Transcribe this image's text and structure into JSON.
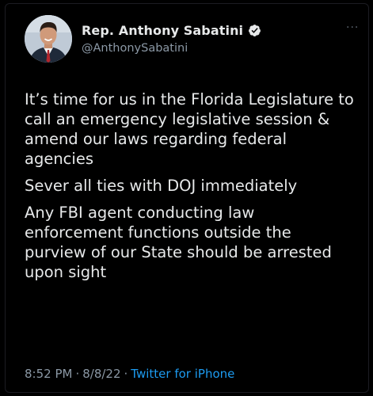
{
  "colors": {
    "background": "#000000",
    "text_primary": "#e7e9ea",
    "text_secondary": "#8b98a5",
    "accent": "#1d9bf0"
  },
  "author": {
    "name": "Rep. Anthony Sabatini",
    "handle": "@AnthonySabatini",
    "verified_icon": "verified-badge-icon",
    "avatar_icon": "profile-photo"
  },
  "more_menu": {
    "label": "···",
    "icon": "more-options-icon"
  },
  "tweet": {
    "paragraphs": [
      "It’s time for us in the Florida Legislature to call an emergency legislative session & amend our laws regarding federal agencies",
      "Sever all ties with DOJ immediately",
      "Any FBI agent conducting law enforcement functions outside the purview of our State should be arrested upon sight"
    ]
  },
  "meta": {
    "time": "8:52 PM",
    "separator": "·",
    "date": "8/8/22",
    "source": "Twitter for iPhone"
  }
}
